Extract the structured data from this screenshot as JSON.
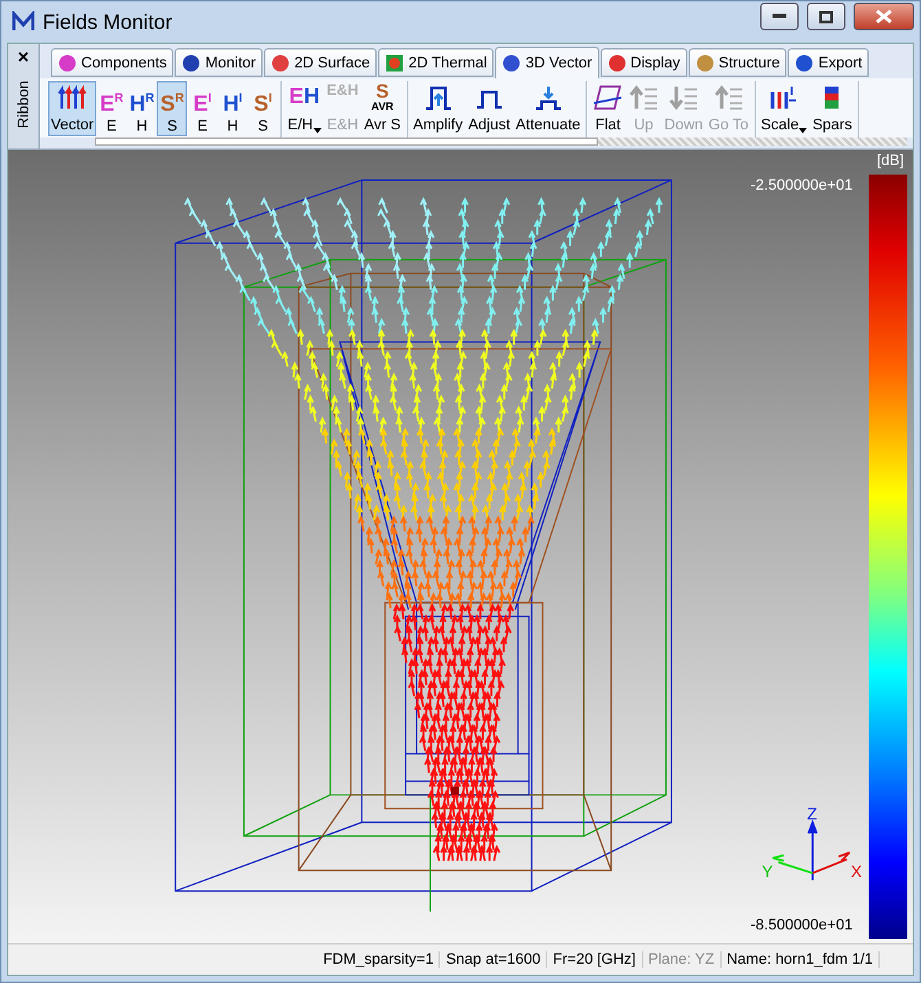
{
  "window": {
    "title": "Fields Monitor"
  },
  "ribbon": {
    "label": "Ribbon",
    "close": "×"
  },
  "tabs": [
    {
      "label": "Components",
      "selected": false
    },
    {
      "label": "Monitor",
      "selected": false
    },
    {
      "label": "2D Surface",
      "selected": false
    },
    {
      "label": "2D Thermal",
      "selected": false
    },
    {
      "label": "3D Vector",
      "selected": true
    },
    {
      "label": "Display",
      "selected": false
    },
    {
      "label": "Structure",
      "selected": false
    },
    {
      "label": "Export",
      "selected": false
    }
  ],
  "tool_groups": [
    {
      "tools": [
        {
          "kind": "vector",
          "label": "Vector",
          "selected": true,
          "disabled": false
        },
        {
          "kind": "glyph",
          "label": "E",
          "glyph": "E",
          "sup": "R",
          "color": "#d63cc8",
          "selected": false,
          "disabled": false
        },
        {
          "kind": "glyph",
          "label": "H",
          "glyph": "H",
          "sup": "R",
          "color": "#2050d0",
          "selected": false,
          "disabled": false
        },
        {
          "kind": "glyph",
          "label": "S",
          "glyph": "S",
          "sup": "R",
          "color": "#b8602a",
          "selected": true,
          "disabled": false
        },
        {
          "kind": "glyph",
          "label": "E",
          "glyph": "E",
          "sup": "I",
          "color": "#d63cc8",
          "selected": false,
          "disabled": false
        },
        {
          "kind": "glyph",
          "label": "H",
          "glyph": "H",
          "sup": "I",
          "color": "#2050d0",
          "selected": false,
          "disabled": false
        },
        {
          "kind": "glyph",
          "label": "S",
          "glyph": "S",
          "sup": "I",
          "color": "#b8602a",
          "selected": false,
          "disabled": false
        }
      ]
    },
    {
      "tools": [
        {
          "kind": "pair",
          "label": "E/H",
          "glyph": "E",
          "glyph2": "H",
          "dropdown": true,
          "selected": false,
          "disabled": false
        },
        {
          "kind": "stack",
          "label": "E&H",
          "glyph": "E&H",
          "selected": false,
          "disabled": true
        },
        {
          "kind": "stack",
          "label": "Avr S",
          "glyph": "S",
          "sub": "AVR",
          "selected": false,
          "disabled": false
        }
      ]
    },
    {
      "tools": [
        {
          "kind": "amplify",
          "label": "Amplify",
          "selected": false,
          "disabled": false
        },
        {
          "kind": "adjust",
          "label": "Adjust",
          "selected": false,
          "disabled": false
        },
        {
          "kind": "attenuate",
          "label": "Attenuate",
          "selected": false,
          "disabled": false
        }
      ]
    },
    {
      "tools": [
        {
          "kind": "flat",
          "label": "Flat",
          "selected": false,
          "disabled": false
        },
        {
          "kind": "up",
          "label": "Up",
          "selected": false,
          "disabled": true
        },
        {
          "kind": "down",
          "label": "Down",
          "selected": false,
          "disabled": true
        },
        {
          "kind": "goto",
          "label": "Go To",
          "selected": false,
          "disabled": true
        }
      ]
    },
    {
      "tools": [
        {
          "kind": "scale",
          "label": "Scale",
          "dropdown": true,
          "selected": false,
          "disabled": false
        },
        {
          "kind": "spars",
          "label": "Spars",
          "selected": false,
          "disabled": false
        }
      ]
    }
  ],
  "viewport": {
    "axes": {
      "x": "X",
      "y": "Y",
      "z": "Z"
    }
  },
  "colorbar": {
    "unit": "[dB]",
    "max": "-2.500000e+01",
    "min": "-8.500000e+01"
  },
  "status_bar": [
    {
      "text": "FDM_sparsity=1",
      "disabled": false
    },
    {
      "text": "Snap at=1600",
      "disabled": false
    },
    {
      "text": "Fr=20 [GHz]",
      "disabled": false
    },
    {
      "text": "Plane: YZ",
      "disabled": true
    },
    {
      "text": "Name: horn1_fdm 1/1",
      "disabled": false
    }
  ]
}
